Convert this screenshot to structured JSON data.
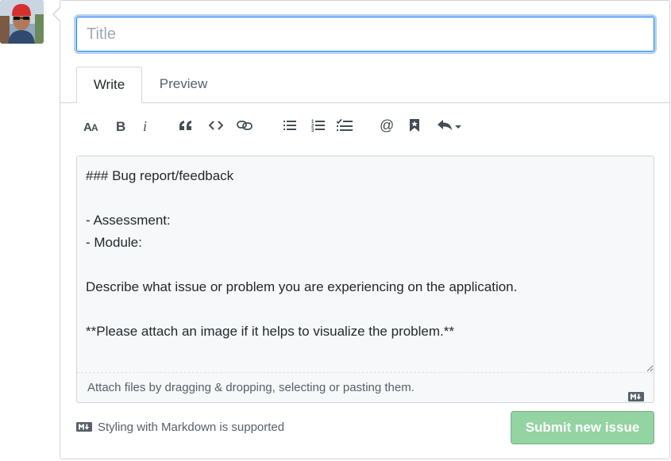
{
  "title_field": {
    "placeholder": "Title",
    "value": ""
  },
  "tabs": [
    {
      "label": "Write",
      "active": true
    },
    {
      "label": "Preview",
      "active": false
    }
  ],
  "toolbar": {
    "icons": [
      "text-size-icon",
      "bold-icon",
      "italic-icon",
      "quote-icon",
      "code-icon",
      "link-icon",
      "unordered-list-icon",
      "ordered-list-icon",
      "task-list-icon",
      "mention-icon",
      "saved-reply-icon",
      "reply-dropdown-icon"
    ]
  },
  "editor": {
    "body": "### Bug report/feedback\n\n- Assessment:\n- Module:\n\nDescribe what issue or problem you are experiencing on the application.\n\n**Please attach an image if it helps to visualize the problem.**",
    "attach_hint": "Attach files by dragging & dropping, selecting or pasting them."
  },
  "footer": {
    "markdown_note": "Styling with Markdown is supported",
    "submit_label": "Submit new issue"
  },
  "colors": {
    "accent_focus": "#2188ff",
    "submit_disabled": "#94d3a2",
    "border": "#d1d5da"
  }
}
